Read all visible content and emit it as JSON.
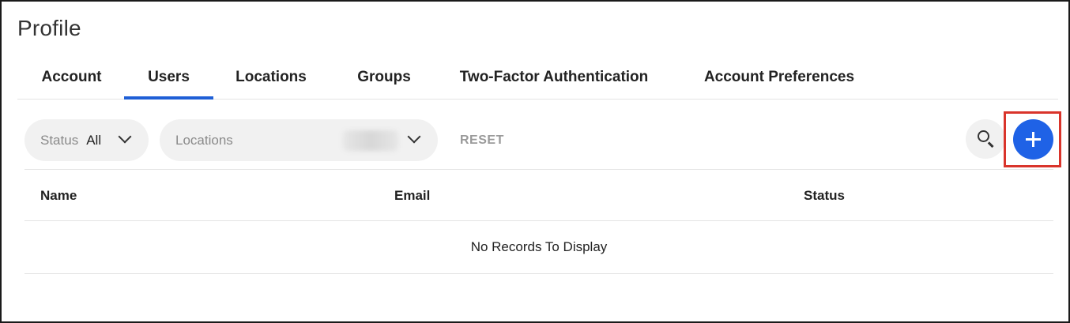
{
  "page": {
    "title": "Profile"
  },
  "tabs": [
    {
      "label": "Account",
      "active": false
    },
    {
      "label": "Users",
      "active": true
    },
    {
      "label": "Locations",
      "active": false
    },
    {
      "label": "Groups",
      "active": false
    },
    {
      "label": "Two-Factor Authentication",
      "active": false
    },
    {
      "label": "Account Preferences",
      "active": false
    }
  ],
  "filters": {
    "status": {
      "label": "Status",
      "value": "All"
    },
    "locations": {
      "placeholder": "Locations",
      "value": ""
    },
    "reset_label": "RESET"
  },
  "actions": {
    "search_icon": "search-icon",
    "add_icon": "plus-icon"
  },
  "table": {
    "columns": [
      "Name",
      "Email",
      "Status"
    ],
    "rows": [],
    "empty_message": "No Records To Display"
  },
  "colors": {
    "accent": "#1f62e6",
    "active_tab_underline": "#1f5fd6",
    "highlight": "#d9342b",
    "pill_bg": "#f1f1f1"
  }
}
